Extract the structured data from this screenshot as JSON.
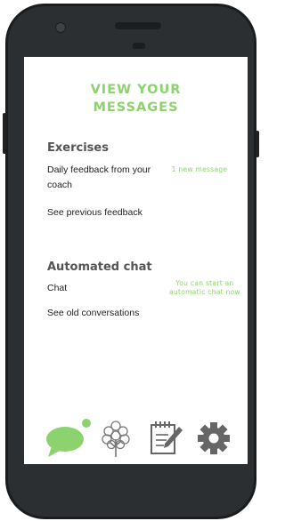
{
  "page": {
    "title_line1": "VIEW YOUR",
    "title_line2": "MESSAGES"
  },
  "exercises": {
    "heading": "Exercises",
    "daily_feedback_line1": "Daily feedback from your",
    "daily_feedback_line2": "coach",
    "new_message_note": "1 new message",
    "see_previous": "See previous feedback"
  },
  "automated_chat": {
    "heading": "Automated chat",
    "chat": "Chat",
    "start_note_line1": "You can start an",
    "start_note_line2": "automatic chat now",
    "see_old": "See old conversations"
  },
  "bottom_nav": {
    "items": [
      {
        "icon": "chat-bubble-icon",
        "active": true,
        "badge": true
      },
      {
        "icon": "tree-icon",
        "active": false
      },
      {
        "icon": "notepad-icon",
        "active": false
      },
      {
        "icon": "gear-icon",
        "active": false
      }
    ]
  },
  "colors": {
    "accent": "#8cd26e",
    "inactive_icon": "#666666",
    "heading_text": "#555555",
    "body_text": "#222222",
    "phone_frame": "#2c2f31"
  }
}
